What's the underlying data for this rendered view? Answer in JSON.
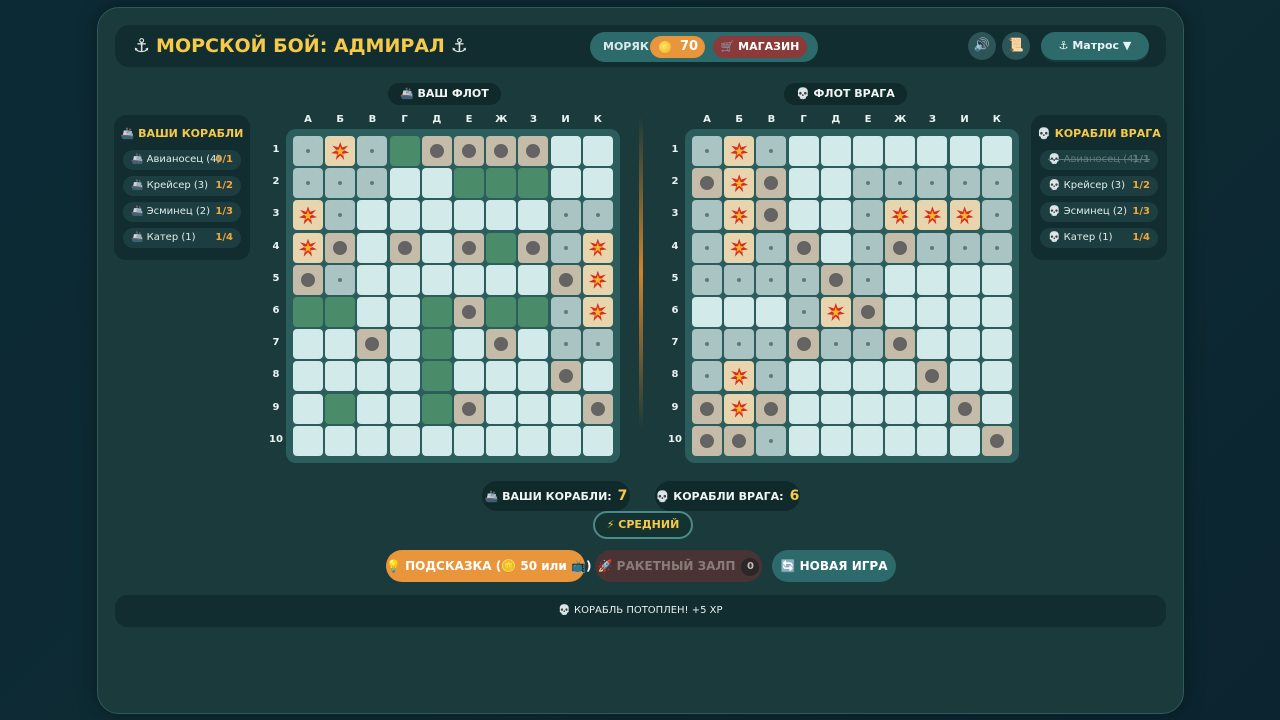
{
  "header": {
    "title": "МОРСКОЙ БОЙ: АДМИРАЛ",
    "anchor_glyph": "⚓",
    "rank": "МОРЯК",
    "coins": "70",
    "shop_label": "🛒 МАГАЗИН",
    "sound_icon": "🔊",
    "scroll_icon": "📜",
    "player_menu": "⚓ Матрос ▼"
  },
  "player_board_label": "🚢 ВАШ ФЛОТ",
  "enemy_board_label": "💀 ФЛОТ ВРАГА",
  "columns": [
    "А",
    "Б",
    "В",
    "Г",
    "Д",
    "Е",
    "Ж",
    "З",
    "И",
    "К"
  ],
  "rows": [
    "1",
    "2",
    "3",
    "4",
    "5",
    "6",
    "7",
    "8",
    "9",
    "10"
  ],
  "player_panel": {
    "title": "🚢 ВАШИ КОРАБЛИ",
    "ships": [
      {
        "name": "🚢 Авианосец (4)",
        "count": "0/1",
        "sunk": false
      },
      {
        "name": "🚢 Крейсер (3)",
        "count": "1/2",
        "sunk": false
      },
      {
        "name": "🚢 Эсминец (2)",
        "count": "1/3",
        "sunk": false
      },
      {
        "name": "🚢 Катер (1)",
        "count": "1/4",
        "sunk": false
      }
    ]
  },
  "enemy_panel": {
    "title": "💀 КОРАБЛИ ВРАГА",
    "ships": [
      {
        "name": "💀 Авианосец (4)",
        "count": "1/1",
        "sunk": true
      },
      {
        "name": "💀 Крейсер (3)",
        "count": "1/2",
        "sunk": false
      },
      {
        "name": "💀 Эсминец (2)",
        "count": "1/3",
        "sunk": false
      },
      {
        "name": "💀 Катер (1)",
        "count": "1/4",
        "sunk": false
      }
    ]
  },
  "legend_note": "cell codes: W water, M miss dot, S ship, H hit, O missed shot marker",
  "player_grid": [
    "MHMSOOOOWW",
    "MMMWWSSSWW",
    "HMWWWWWWMM",
    "HOWOWOSOMH",
    "OMWWWWWWOH",
    "SSWWSOSSMH",
    "WWOWSWOWMM",
    "WWWWSWWWOW",
    "WSWWSOWWWO",
    "WWWWWWWWWW"
  ],
  "enemy_grid": [
    "MHMWWWWWWW",
    "OHOWWMMMMM",
    "MHOWWMHHHM",
    "MHMOWMOMMM",
    "MMMMOMWWWW",
    "WWWMHOWWWW",
    "MMMOMMOWWW",
    "MHMWWWWOWW",
    "OHOWWWWWOW",
    "OOMWWWWWWO"
  ],
  "stats": {
    "player_label": "🚢 ВАШИ КОРАБЛИ:",
    "player_value": "7",
    "enemy_label": "💀 КОРАБЛИ ВРАГА:",
    "enemy_value": "6"
  },
  "difficulty": "⚡ СРЕДНИЙ",
  "buttons": {
    "hint": "💡 ПОДСКАЗКА (🪙 50 или 📺)",
    "rocket": "🚀 РАКЕТНЫЙ ЗАЛП",
    "rocket_count": "0",
    "new_game": "🔄 НОВАЯ ИГРА"
  },
  "log_message": "💀 КОРАБЛЬ ПОТОПЛЕН! +5 XP",
  "colors": {
    "accent_gold": "#f6c948",
    "water": "#d2eaea",
    "miss": "#a9c4c3",
    "ship": "#4a8c6a",
    "hit": "#e8d4ad",
    "orange": "#e9953b"
  }
}
